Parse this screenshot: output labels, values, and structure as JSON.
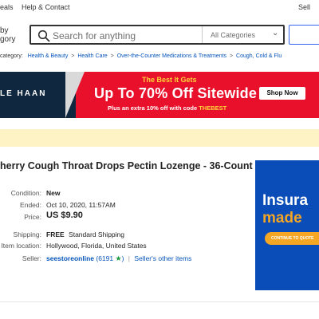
{
  "top_links": {
    "deals": "eals",
    "help": "Help & Contact",
    "sell": "Sell"
  },
  "header": {
    "shop_by_category_line1": "by",
    "shop_by_category_line2": "gory",
    "search_placeholder": "Search for anything",
    "category_select": "All Categories"
  },
  "breadcrumb": {
    "prefix": "category:",
    "items": [
      "Health & Beauty",
      "Health Care",
      "Over-the-Counter Medications & Treatments",
      "Cough, Cold & Flu"
    ],
    "separator": ">"
  },
  "banner": {
    "brand": "LE HAAN",
    "kicker": "The Best It Gets",
    "headline": "Up To 70% Off Sitewide",
    "subline_prefix": "Plus an extra 10% off with code ",
    "code": "THEBEST",
    "cta": "Shop Now",
    "colors": {
      "red": "#e8102a",
      "navy": "#0f2840",
      "yellow": "#ffd43a"
    }
  },
  "item": {
    "title": "herry Cough Throat Drops Pectin Lozenge - 36-Count -",
    "condition_label": "Condition:",
    "condition": "New",
    "ended_label": "Ended:",
    "ended": "Oct 10, 2020, 11:57AM",
    "price_label": "Price:",
    "price": "US $9.90",
    "shipping_label": "Shipping:",
    "shipping_cost": "FREE",
    "shipping_method": "Standard Shipping",
    "location_label": "Item location:",
    "location": "Hollywood, Florida, United States",
    "seller_label": "Seller:",
    "seller_name": "seestoreonline",
    "seller_score": "(6191",
    "seller_score_end": ")",
    "seller_other": "Seller's other items"
  },
  "ad": {
    "word1": "Insura",
    "word2": "made",
    "cta": "CONTINUE TO QUOTE"
  }
}
